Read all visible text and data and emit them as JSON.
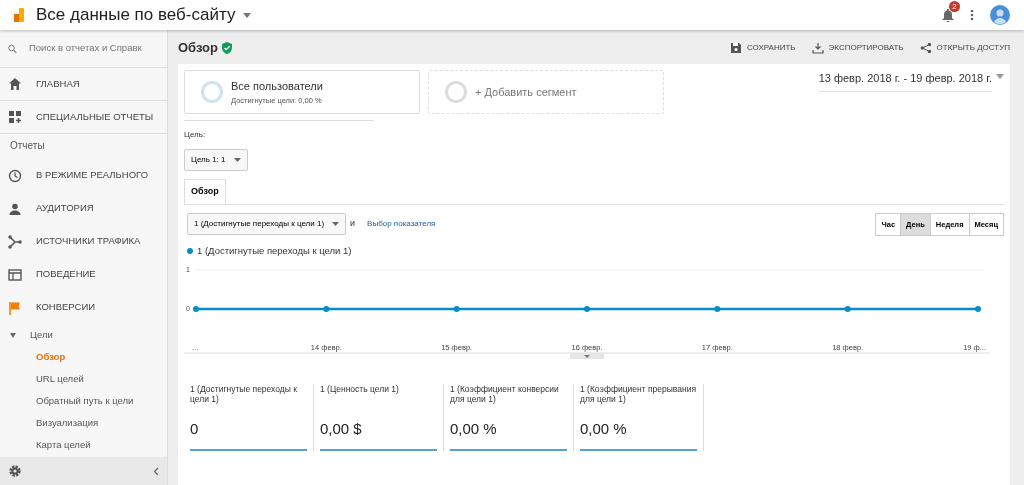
{
  "header": {
    "title": "Все данные по веб-сайту",
    "notification_count": "2"
  },
  "sidebar": {
    "search_placeholder": "Поиск в отчетах и Справк",
    "top_items": [
      {
        "label": "ГЛАВНАЯ",
        "selected": false
      },
      {
        "label": "СПЕЦИАЛЬНЫЕ ОТЧЕТЫ",
        "selected": false
      }
    ],
    "section_label": "Отчеты",
    "report_items": [
      {
        "label": "В РЕЖИМЕ РЕАЛЬНОГО",
        "selected": false
      },
      {
        "label": "АУДИТОРИЯ",
        "selected": false
      },
      {
        "label": "ИСТОЧНИКИ ТРАФИКА",
        "selected": false
      },
      {
        "label": "ПОВЕДЕНИЕ",
        "selected": false
      },
      {
        "label": "КОНВЕРСИИ",
        "selected": true,
        "children": [
          {
            "label": "Цели",
            "expanded": true,
            "children": [
              {
                "label": "Обзор",
                "selected": true
              },
              {
                "label": "URL целей",
                "selected": false
              },
              {
                "label": "Обратный путь к цели",
                "selected": false
              },
              {
                "label": "Визуализация",
                "selected": false
              },
              {
                "label": "Карта целей",
                "selected": false
              }
            ]
          }
        ]
      }
    ]
  },
  "page": {
    "title": "Обзор",
    "verified": true,
    "actions": [
      "СОХРАНИТЬ",
      "ЭКСПОРТИРОВАТЬ",
      "ОТКРЫТЬ ДОСТУП"
    ]
  },
  "segments": [
    {
      "title": "Все пользователи",
      "subtitle": "Достигнутые цели: 0,00 %"
    }
  ],
  "add_segment": "+ Добавить сегмент",
  "date_range": "13 февр. 2018 г. - 19 февр. 2018 г.",
  "goal": {
    "label": "Цель:",
    "value": "Цель 1: 1"
  },
  "tabs": [
    {
      "label": "Обзор",
      "selected": true
    }
  ],
  "metric_select": "1 (Достигнутые переходы к цели 1)",
  "connector": "и",
  "metric_link": "Выбор показателя",
  "granularity": [
    {
      "label": "Час",
      "selected": false
    },
    {
      "label": "День",
      "selected": true
    },
    {
      "label": "Неделя",
      "selected": false
    },
    {
      "label": "Месяц",
      "selected": false
    }
  ],
  "chart_data": {
    "type": "line",
    "categories": [
      "...",
      "14 февр.",
      "15 февр.",
      "16 февр.",
      "17 февр.",
      "18 февр.",
      "19 ф..."
    ],
    "yticks": [
      0,
      1
    ],
    "ylim": [
      0,
      1
    ],
    "series": [
      {
        "name": "1 (Достигнутые переходы к цели 1)",
        "color": "#058dc7",
        "marker": "circle",
        "values": [
          0,
          0,
          0,
          0,
          0,
          0,
          0
        ]
      }
    ]
  },
  "scorecards": [
    {
      "label": "1 (Достигнутые переходы к цели 1)",
      "value": "0"
    },
    {
      "label": "1 (Ценность цели 1)",
      "value": "0,00 $"
    },
    {
      "label": "1 (Коэффициент конверсии для цели 1)",
      "value": "0,00 %"
    },
    {
      "label": "1 (Коэффициент прерывания для цели 1)",
      "value": "0,00 %"
    }
  ]
}
